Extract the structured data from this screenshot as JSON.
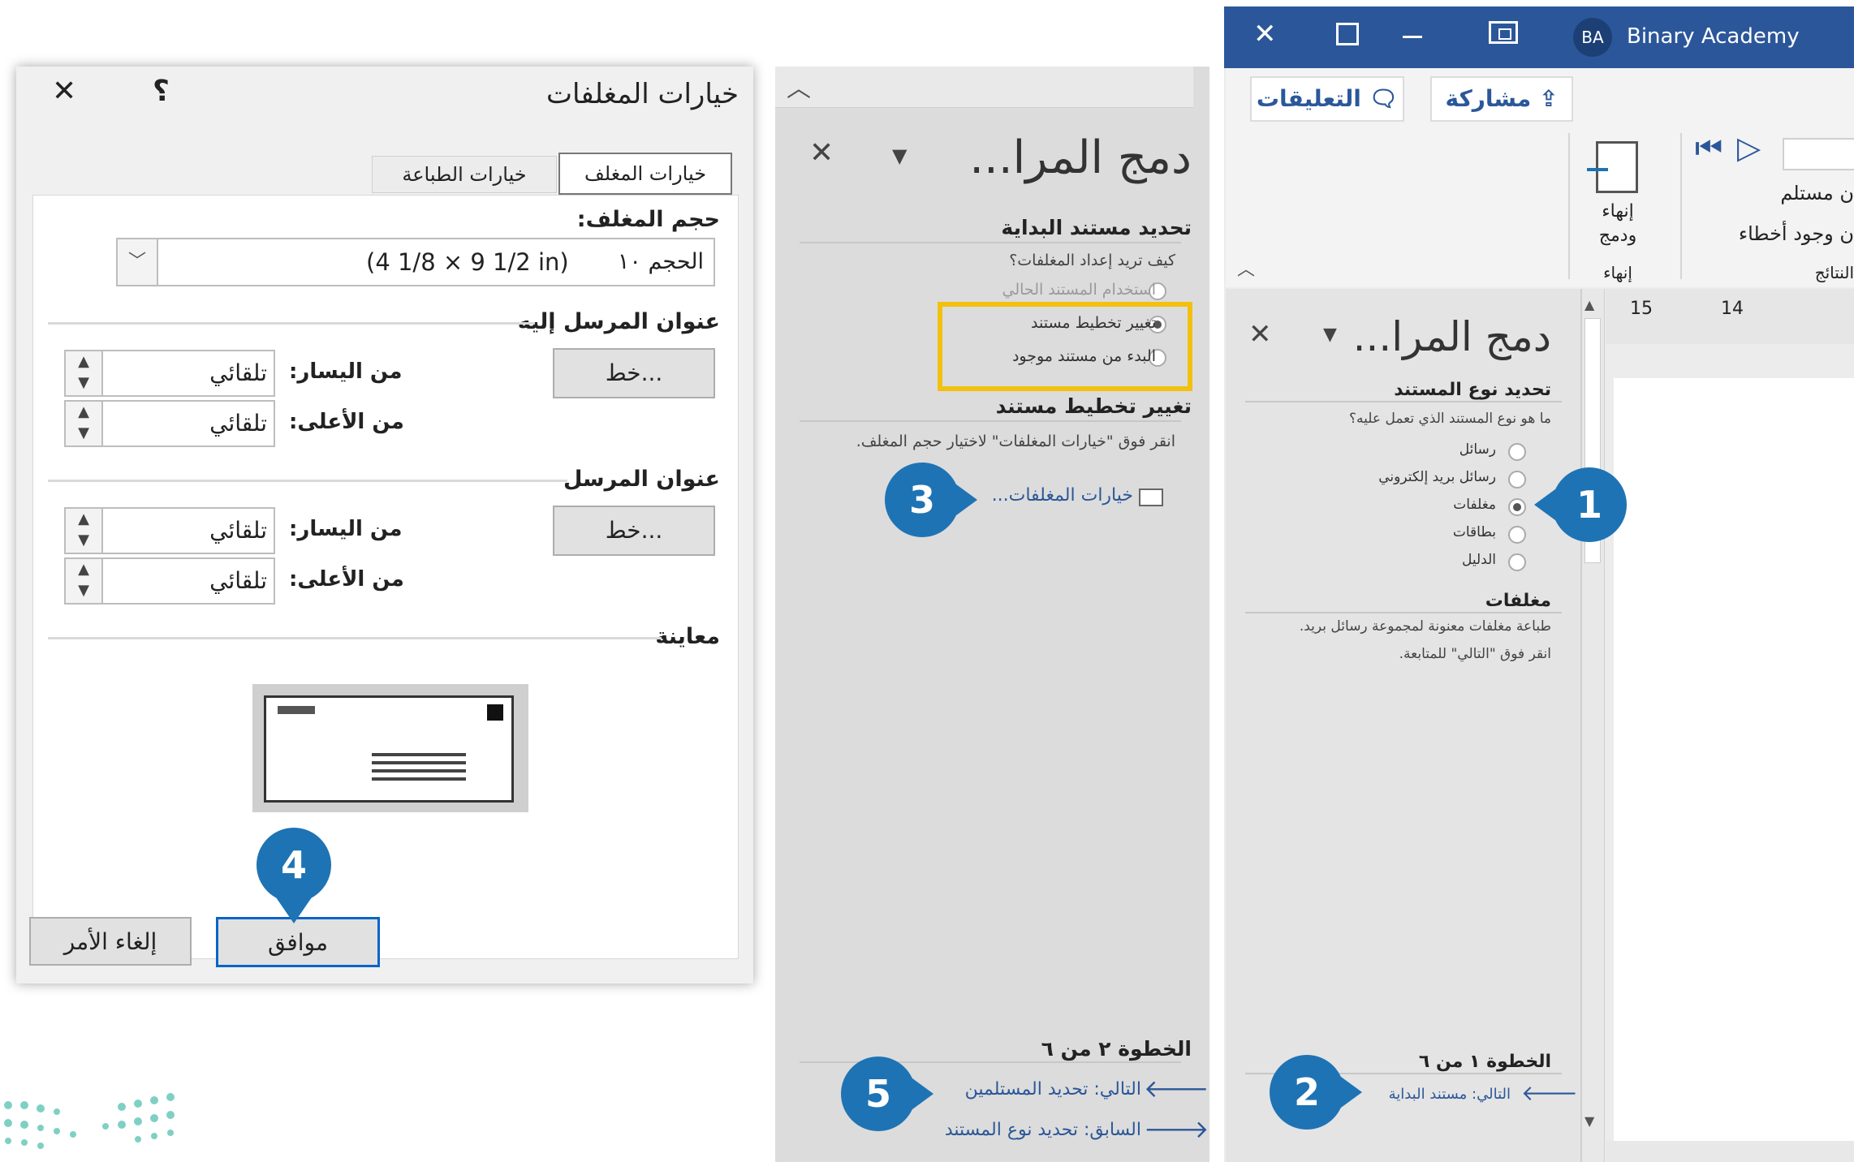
{
  "envelope_dialog": {
    "title": "خيارات المغلفات",
    "help": "؟",
    "close": "✕",
    "tabs": [
      "خيارات المغلف",
      "خيارات الطباعة"
    ],
    "size_label": "حجم المغلف:",
    "size_value": "الحجم ١٠",
    "size_dims": "(4 1/8 × 9 1/2 in)",
    "delivery_label": "عنوان المرسل إليه",
    "return_label": "عنوان المرسل",
    "font_button": "خط...",
    "from_left": "من اليسار:",
    "from_top": "من الأعلى:",
    "auto": "تلقائي",
    "preview_label": "معاينة",
    "ok": "موافق",
    "cancel": "إلغاء الأمر"
  },
  "pane_step2": {
    "title": "دمج المرا...",
    "section1": "تحديد مستند البداية",
    "question": "كيف تريد إعداد المغلفات؟",
    "options": [
      "استخدام المستند الحالي",
      "تغيير تخطيط مستند",
      "البدء من مستند موجود"
    ],
    "section2": "تغيير تخطيط مستند",
    "desc": "انقر فوق \"خيارات المغلفات\" لاختيار حجم المغلف.",
    "envelope_link": "خيارات المغلفات...",
    "step": "الخطوة ٢ من ٦",
    "next": "التالي: تحديد المستلمين",
    "prev": "السابق: تحديد نوع المستند"
  },
  "word": {
    "user_initials": "BA",
    "user_name": "Binary Academy",
    "share": "مشاركة",
    "comments": "التعليقات",
    "finish_label": "إنهاء ودمج",
    "finish_group": "إنهاء",
    "recipient_partial": "ن مستلم",
    "errors_partial": "ن وجود أخطاء",
    "results_partial": "النتائج",
    "ruler": [
      "15",
      "14"
    ]
  },
  "pane_step1": {
    "title": "دمج المرا...",
    "section1": "تحديد نوع المستند",
    "question": "ما هو نوع المستند الذي تعمل عليه؟",
    "options": [
      "رسائل",
      "رسائل بريد إلكتروني",
      "مغلفات",
      "بطاقات",
      "الدليل"
    ],
    "section2": "مغلفات",
    "desc1": "طباعة مغلفات معنونة لمجموعة رسائل بريد.",
    "desc2": "انقر فوق \"التالي\" للمتابعة.",
    "step": "الخطوة ١ من ٦",
    "next": "التالي: مستند البداية"
  },
  "callouts": [
    "1",
    "2",
    "3",
    "4",
    "5"
  ],
  "colors": {
    "accent": "#1e73b4",
    "titlebar": "#2b579a",
    "highlight": "#f2c10f",
    "button_focus": "#0a64c8"
  }
}
